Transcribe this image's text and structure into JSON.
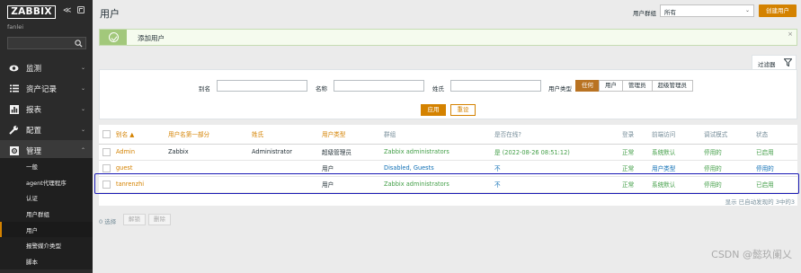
{
  "sidebar": {
    "logo": "ZABBIX",
    "user": "fanlei",
    "collapse_glyph": "≪",
    "search_placeholder": "",
    "menu": [
      {
        "label": "监测",
        "icon": "eye-icon"
      },
      {
        "label": "资产记录",
        "icon": "list-icon"
      },
      {
        "label": "报表",
        "icon": "bar-chart-icon"
      },
      {
        "label": "配置",
        "icon": "wrench-icon"
      },
      {
        "label": "管理",
        "icon": "gear-icon"
      }
    ],
    "submenu": [
      "一般",
      "agent代理程序",
      "认证",
      "用户群组",
      "用户",
      "报警媒介类型",
      "脚本"
    ],
    "selected_submenu": "用户"
  },
  "header": {
    "title": "用户",
    "group_label": "用户群组",
    "group_value": "所有",
    "create_button": "创建用户"
  },
  "message": {
    "text": "添加用户",
    "close": "×"
  },
  "filter": {
    "tab_label": "过滤器",
    "alias_label": "别名",
    "name_label": "名称",
    "surname_label": "姓氏",
    "user_type_label": "用户类型",
    "user_type_options": [
      "任何",
      "用户",
      "管理员",
      "超级管理员"
    ],
    "user_type_selected": "任何",
    "apply_button": "应用",
    "reset_button": "重设"
  },
  "table": {
    "columns": [
      "别名 ▲",
      "用户名第一部分",
      "姓氏",
      "用户类型",
      "群组",
      "是否在线?",
      "登录",
      "前端访问",
      "调试模式",
      "状态"
    ],
    "rows": [
      {
        "alias": "Admin",
        "name": "Zabbix",
        "surname": "Administrator",
        "type": "超级管理员",
        "groups": "Zabbix administrators",
        "online": "是 (2022-08-26 08:51:12)",
        "login": "正常",
        "frontend": "系统默认",
        "debug": "停用的",
        "status": "已启用"
      },
      {
        "alias": "guest",
        "name": "",
        "surname": "",
        "type": "用户",
        "groups": "Disabled, Guests",
        "online": "不",
        "login": "正常",
        "frontend": "用户类型",
        "debug": "停用的",
        "status": "停用的"
      },
      {
        "alias": "tanrenzhi",
        "name": "",
        "surname": "",
        "type": "用户",
        "groups": "Zabbix administrators",
        "online": "不",
        "login": "正常",
        "frontend": "系统默认",
        "debug": "停用的",
        "status": "已启用"
      }
    ],
    "footer": "显示 已自动发现的 3中的3"
  },
  "actions": {
    "selected_count": "0 选择",
    "unblock_button": "解锁",
    "delete_button": "删除"
  },
  "watermark": "CSDN @懿玖阑乂",
  "colors": {
    "accent": "#d48200",
    "sidebar_bg": "#2b2b2b",
    "success_green": "#429e47",
    "link_blue": "#0f6fb5",
    "highlight_border": "#1a1ab5"
  }
}
